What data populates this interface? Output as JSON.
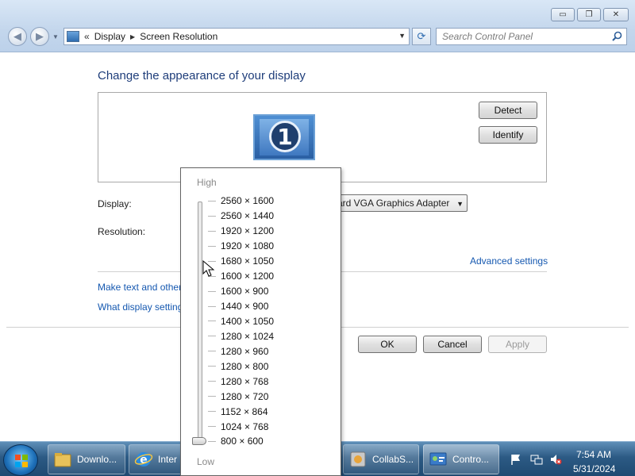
{
  "window": {
    "caption_minimize": "▭",
    "caption_restore": "❐",
    "caption_close": "✕"
  },
  "address_bar": {
    "chevron": "«",
    "segments": [
      "Display",
      "Screen Resolution"
    ],
    "search_placeholder": "Search Control Panel"
  },
  "page": {
    "heading": "Change the appearance of your display",
    "monitor_number": "1",
    "detect_label": "Detect",
    "identify_label": "Identify",
    "display_label": "Display:",
    "display_value": "ard VGA Graphics Adapter",
    "resolution_label": "Resolution:",
    "advanced_settings_link": "Advanced settings",
    "link_text_size": "Make text and other",
    "link_settings": "What display setting",
    "ok_label": "OK",
    "cancel_label": "Cancel",
    "apply_label": "Apply"
  },
  "resolution_popup": {
    "high_label": "High",
    "low_label": "Low",
    "selected": "800 × 600",
    "options": [
      "2560 × 1600",
      "2560 × 1440",
      "1920 × 1200",
      "1920 × 1080",
      "1680 × 1050",
      "1600 × 1200",
      "1600 × 900",
      "1440 × 900",
      "1400 × 1050",
      "1280 × 1024",
      "1280 × 960",
      "1280 × 800",
      "1280 × 768",
      "1280 × 720",
      "1152 × 864",
      "1024 × 768",
      "800 × 600"
    ]
  },
  "taskbar": {
    "items": [
      {
        "label": "Downlo...",
        "icon": "folder-icon"
      },
      {
        "label": "Inter",
        "icon": "internet-explorer-icon"
      },
      {
        "label": "CollabS...",
        "icon": "collab-app-icon"
      },
      {
        "label": "Contro...",
        "icon": "control-panel-icon"
      }
    ],
    "clock_time": "7:54 AM",
    "clock_date": "5/31/2024"
  },
  "colors": {
    "heading": "#1e3d7a",
    "link": "#1558b0",
    "taskbar": "#2c5a84"
  }
}
